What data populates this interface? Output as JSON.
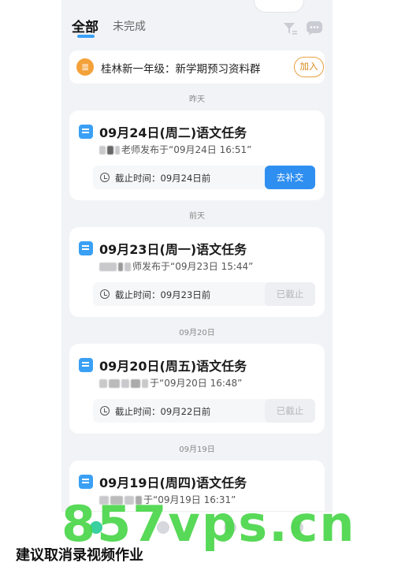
{
  "tabs": {
    "all": "全部",
    "undone": "未完成"
  },
  "banner": {
    "text": "桂林新一年级：新学期预习资料群",
    "join": "加入"
  },
  "groups": [
    {
      "date": "昨天",
      "title": "09月24日(周二)语文任务",
      "sub_suffix": "老师发布于“09月24日 16:51”",
      "deadline": "截止时间：09月24日前",
      "action": "去补交",
      "active": true
    },
    {
      "date": "前天",
      "title": "09月23日(周一)语文任务",
      "sub_suffix": "师发布于“09月23日 15:44”",
      "deadline": "截止时间：09月23日前",
      "action": "已截止",
      "active": false
    },
    {
      "date": "09月20日",
      "title": "09月20日(周五)语文任务",
      "sub_suffix": "于“09月20日 16:48”",
      "deadline": "截止时间：09月22日前",
      "action": "已截止",
      "active": false
    },
    {
      "date": "09月19日",
      "title": "09月19日(周四)语文任务",
      "sub_suffix": "于“09月19日 16:31”"
    }
  ],
  "caption": "建议取消录视频作业",
  "watermark": "857vps.cn",
  "colors": {
    "accent": "#2f8ff0",
    "banner_icon": "#f4a13a",
    "watermark": "#4ad64a"
  }
}
